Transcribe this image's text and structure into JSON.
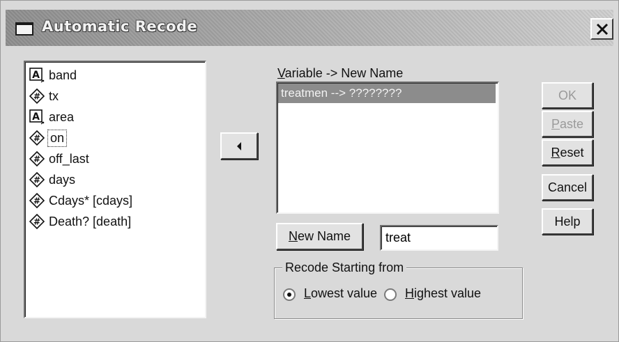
{
  "window": {
    "title": "Automatic Recode"
  },
  "variables": [
    {
      "name": "band",
      "icon": "string-variable-icon"
    },
    {
      "name": "tx",
      "icon": "numeric-variable-icon"
    },
    {
      "name": "area",
      "icon": "string-variable-icon"
    },
    {
      "name": "on",
      "icon": "numeric-variable-icon",
      "focused": true
    },
    {
      "name": "off_last",
      "icon": "numeric-variable-icon"
    },
    {
      "name": "days",
      "icon": "numeric-variable-icon"
    },
    {
      "name": "Cdays* [cdays]",
      "icon": "numeric-variable-icon"
    },
    {
      "name": "Death? [death]",
      "icon": "numeric-variable-icon"
    }
  ],
  "mapping": {
    "label_underline": "V",
    "label_rest": "ariable -> New Name",
    "items": [
      "treatmen --> ????????"
    ]
  },
  "new_name": {
    "button_underline": "N",
    "button_rest": "ew Name",
    "value": "treat"
  },
  "recode": {
    "legend": "Recode Starting from",
    "lowest_underline": "L",
    "lowest_rest": "owest value",
    "highest_underline": "H",
    "highest_rest": "ighest value",
    "selected": "lowest"
  },
  "buttons": {
    "ok": "OK",
    "paste_underline": "P",
    "paste_rest": "aste",
    "reset_underline": "R",
    "reset_rest": "eset",
    "cancel": "Cancel",
    "help": "Help"
  },
  "colors": {
    "selection": "#8c8c8c",
    "dialog_bg": "#d9d9d9"
  }
}
